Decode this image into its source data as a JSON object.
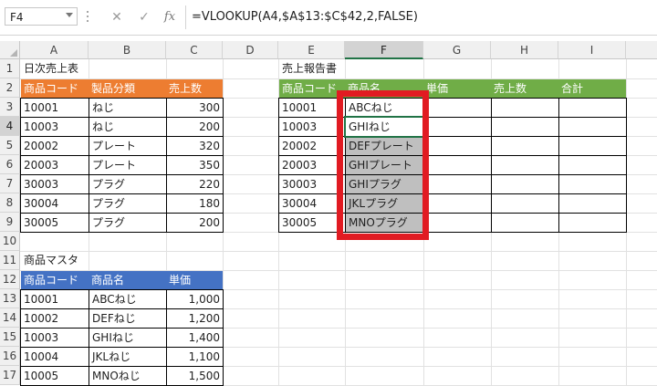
{
  "formula_bar": {
    "name_box": "F4",
    "cancel_symbol": "✕",
    "enter_symbol": "✓",
    "fx_label": "fx",
    "formula": "=VLOOKUP(A4,$A$13:$C$42,2,FALSE)"
  },
  "columns": [
    "A",
    "B",
    "C",
    "D",
    "E",
    "F",
    "G",
    "H",
    "I"
  ],
  "rows": [
    "1",
    "2",
    "3",
    "4",
    "5",
    "6",
    "7",
    "8",
    "9",
    "10",
    "11",
    "12",
    "13",
    "14",
    "15",
    "16",
    "17"
  ],
  "daily_sales": {
    "title": "日次売上表",
    "headers": [
      "商品コード",
      "製品分類",
      "売上数"
    ],
    "rows": [
      [
        "10001",
        "ねじ",
        "300"
      ],
      [
        "10003",
        "ねじ",
        "200"
      ],
      [
        "20002",
        "プレート",
        "320"
      ],
      [
        "20003",
        "プレート",
        "350"
      ],
      [
        "30003",
        "プラグ",
        "220"
      ],
      [
        "30004",
        "プラグ",
        "180"
      ],
      [
        "30005",
        "プラグ",
        "200"
      ]
    ]
  },
  "sales_report": {
    "title": "売上報告書",
    "headers": [
      "商品コード",
      "商品名",
      "単価",
      "売上数",
      "合計"
    ],
    "rows": [
      [
        "10001",
        "ABCねじ"
      ],
      [
        "10003",
        "GHIねじ"
      ],
      [
        "20002",
        "DEFプレート"
      ],
      [
        "20003",
        "GHIプレート"
      ],
      [
        "30003",
        "GHIプラグ"
      ],
      [
        "30004",
        "JKLプラグ"
      ],
      [
        "30005",
        "MNOプラグ"
      ]
    ]
  },
  "product_master": {
    "title": "商品マスタ",
    "headers": [
      "商品コード",
      "商品名",
      "単価"
    ],
    "rows": [
      [
        "10001",
        "ABCねじ",
        "1,000"
      ],
      [
        "10002",
        "DEFねじ",
        "1,200"
      ],
      [
        "10003",
        "GHIねじ",
        "1,400"
      ],
      [
        "10004",
        "JKLねじ",
        "1,100"
      ],
      [
        "10005",
        "MNOねじ",
        "1,500"
      ]
    ]
  },
  "colors": {
    "daily_header": "#ed7d31",
    "report_header": "#70ad47",
    "master_header": "#4472c4",
    "highlight_box": "#e11b22",
    "filled_cells": "#bfbfbf"
  }
}
